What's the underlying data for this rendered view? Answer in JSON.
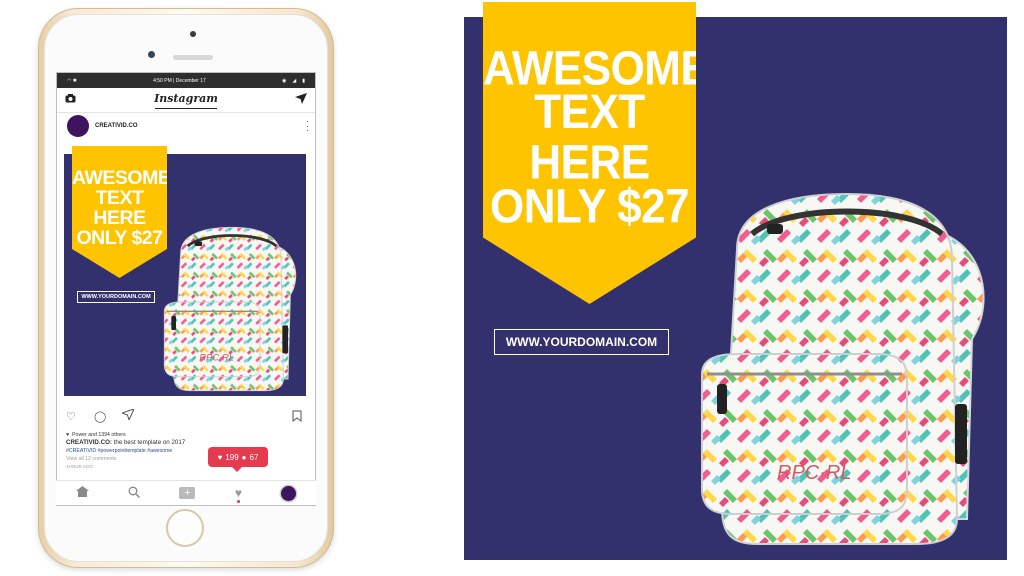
{
  "phone": {
    "status_time": "4:50 PM | December 17",
    "app_title": "Instagram",
    "post": {
      "username": "CREATIVID.CO",
      "likes_text": "Power and 1394 others",
      "caption_user": "CREATIVID.CO:",
      "caption_text": " the best template on 2017",
      "hashtags": "#CREATIVID #powerpointtemplate #awesome",
      "comments_link": "View all 12 comments",
      "time_ago": "1HOUR AGO"
    },
    "notification": {
      "likes": "199",
      "followers": "67"
    }
  },
  "ad": {
    "headline_lines": [
      "AWESOME",
      "TEXT HERE",
      "ONLY $27"
    ],
    "domain": "WWW.YOURDOMAIN.COM",
    "bag_logo": "RPC·RL"
  },
  "colors": {
    "ad_background": "#32316e",
    "ribbon": "#ffc400",
    "notification": "#e53b4e",
    "avatar": "#3f145e"
  },
  "icons": [
    "camera-icon",
    "direct-send-icon",
    "more-dots-icon",
    "heart-icon",
    "comment-icon",
    "share-icon",
    "bookmark-icon",
    "home-icon",
    "search-icon",
    "add-icon",
    "user-icon"
  ]
}
